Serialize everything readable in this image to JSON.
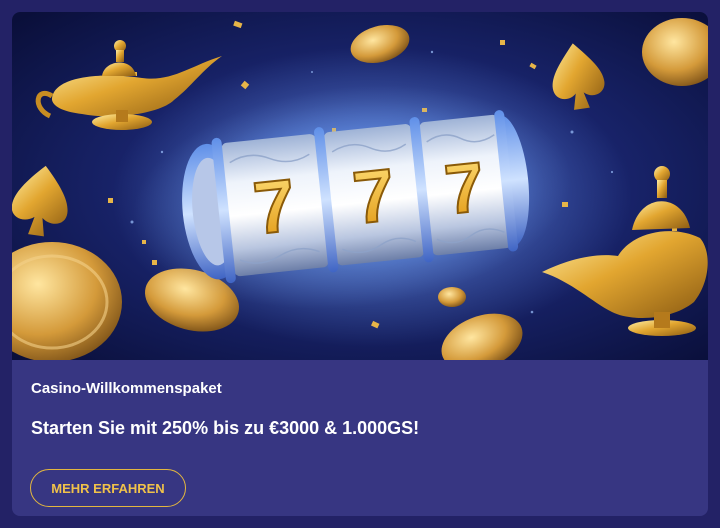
{
  "promo": {
    "subtitle": "Casino-Willkommenspaket",
    "headline": "Starten Sie mit 250% bis zu €3000 & 1.000GS!",
    "cta_label": "MEHR ERFAHREN"
  },
  "banner": {
    "reel_symbols": [
      "7",
      "7",
      "7"
    ],
    "icons": [
      "magic-lamp-icon",
      "spade-icon",
      "gold-coin-icon",
      "slot-reel-icon"
    ]
  },
  "colors": {
    "page_background": "#232266",
    "card_background": "#373682",
    "accent_gold": "#f0c24a",
    "text": "#ffffff"
  }
}
